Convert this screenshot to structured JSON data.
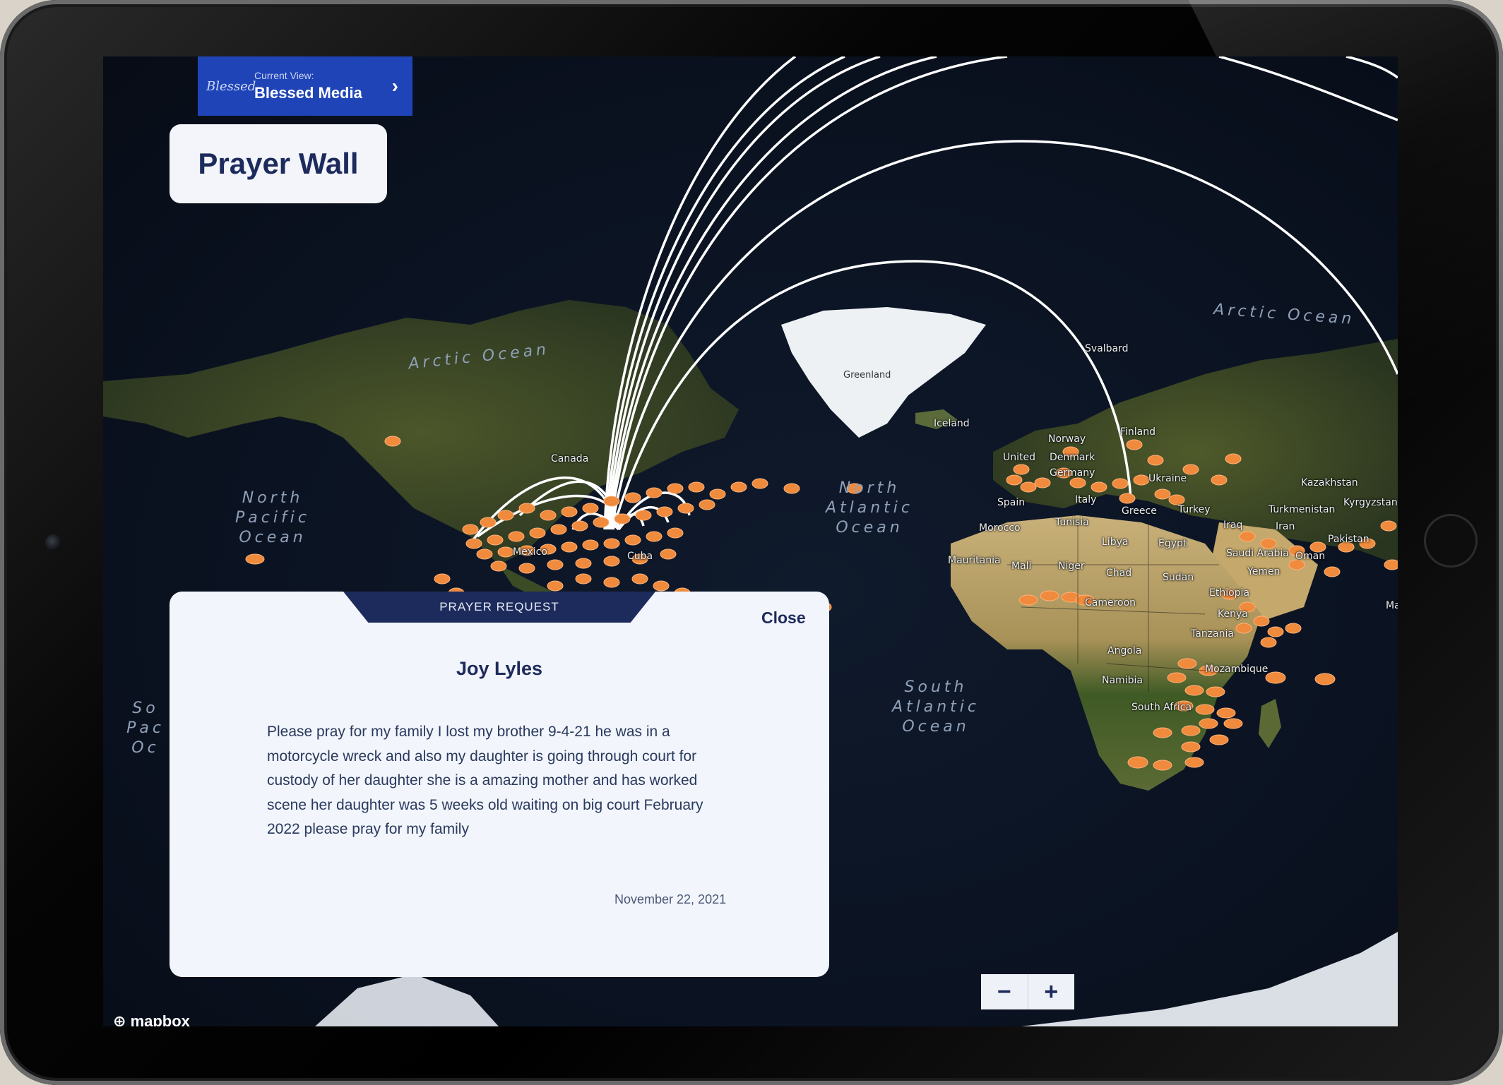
{
  "current_view": {
    "label": "Current View:",
    "value": "Blessed Media",
    "logo_text": "Blessed"
  },
  "page_title": "Prayer Wall",
  "prayer_request": {
    "tab_label": "PRAYER REQUEST",
    "close_label": "Close",
    "name": "Joy Lyles",
    "body": "Please pray for my family  I lost my brother 9-4-21 he was in a motorcycle wreck and also my daughter is going through court for custody of her daughter she is a amazing mother and has worked scene her daughter was 5 weeks old waiting on big court February 2022 please pray for my family",
    "date": "November 22, 2021"
  },
  "zoom": {
    "out_label": "−",
    "in_label": "+"
  },
  "attribution": "mapbox",
  "map": {
    "oceans": [
      {
        "name": "Arctic Ocean"
      },
      {
        "name": "Arctic Ocean"
      },
      {
        "name": "North Pacific Ocean"
      },
      {
        "name": "North Atlantic Ocean"
      },
      {
        "name": "South Atlantic Ocean"
      },
      {
        "name": "So Pac Oc"
      }
    ],
    "places": [
      "Greenland",
      "Iceland",
      "Svalbard",
      "Canada",
      "Mexico",
      "Cuba",
      "Norway",
      "Finland",
      "Denmark",
      "United",
      "Germany",
      "Ukraine",
      "Spain",
      "Italy",
      "Greece",
      "Turkey",
      "Morocco",
      "Tunisia",
      "Libya",
      "Egypt",
      "Iraq",
      "Iran",
      "Kazakhstan",
      "Turkmenistan",
      "Kyrgyzstan",
      "Pakistan",
      "Saudi Arabia",
      "Oman",
      "Yemen",
      "Mauritania",
      "Mali",
      "Niger",
      "Chad",
      "Sudan",
      "Ethiopia",
      "Cameroon",
      "Kenya",
      "Tanzania",
      "Angola",
      "Mozambique",
      "Namibia",
      "South Africa",
      "Ma"
    ],
    "colors": {
      "marker": "#f08a3c",
      "arc": "#ffffff",
      "ocean": "#0b1322",
      "panel": "#f2f5fb",
      "brand_blue": "#1f44b8",
      "navy": "#1d2b5c"
    }
  }
}
